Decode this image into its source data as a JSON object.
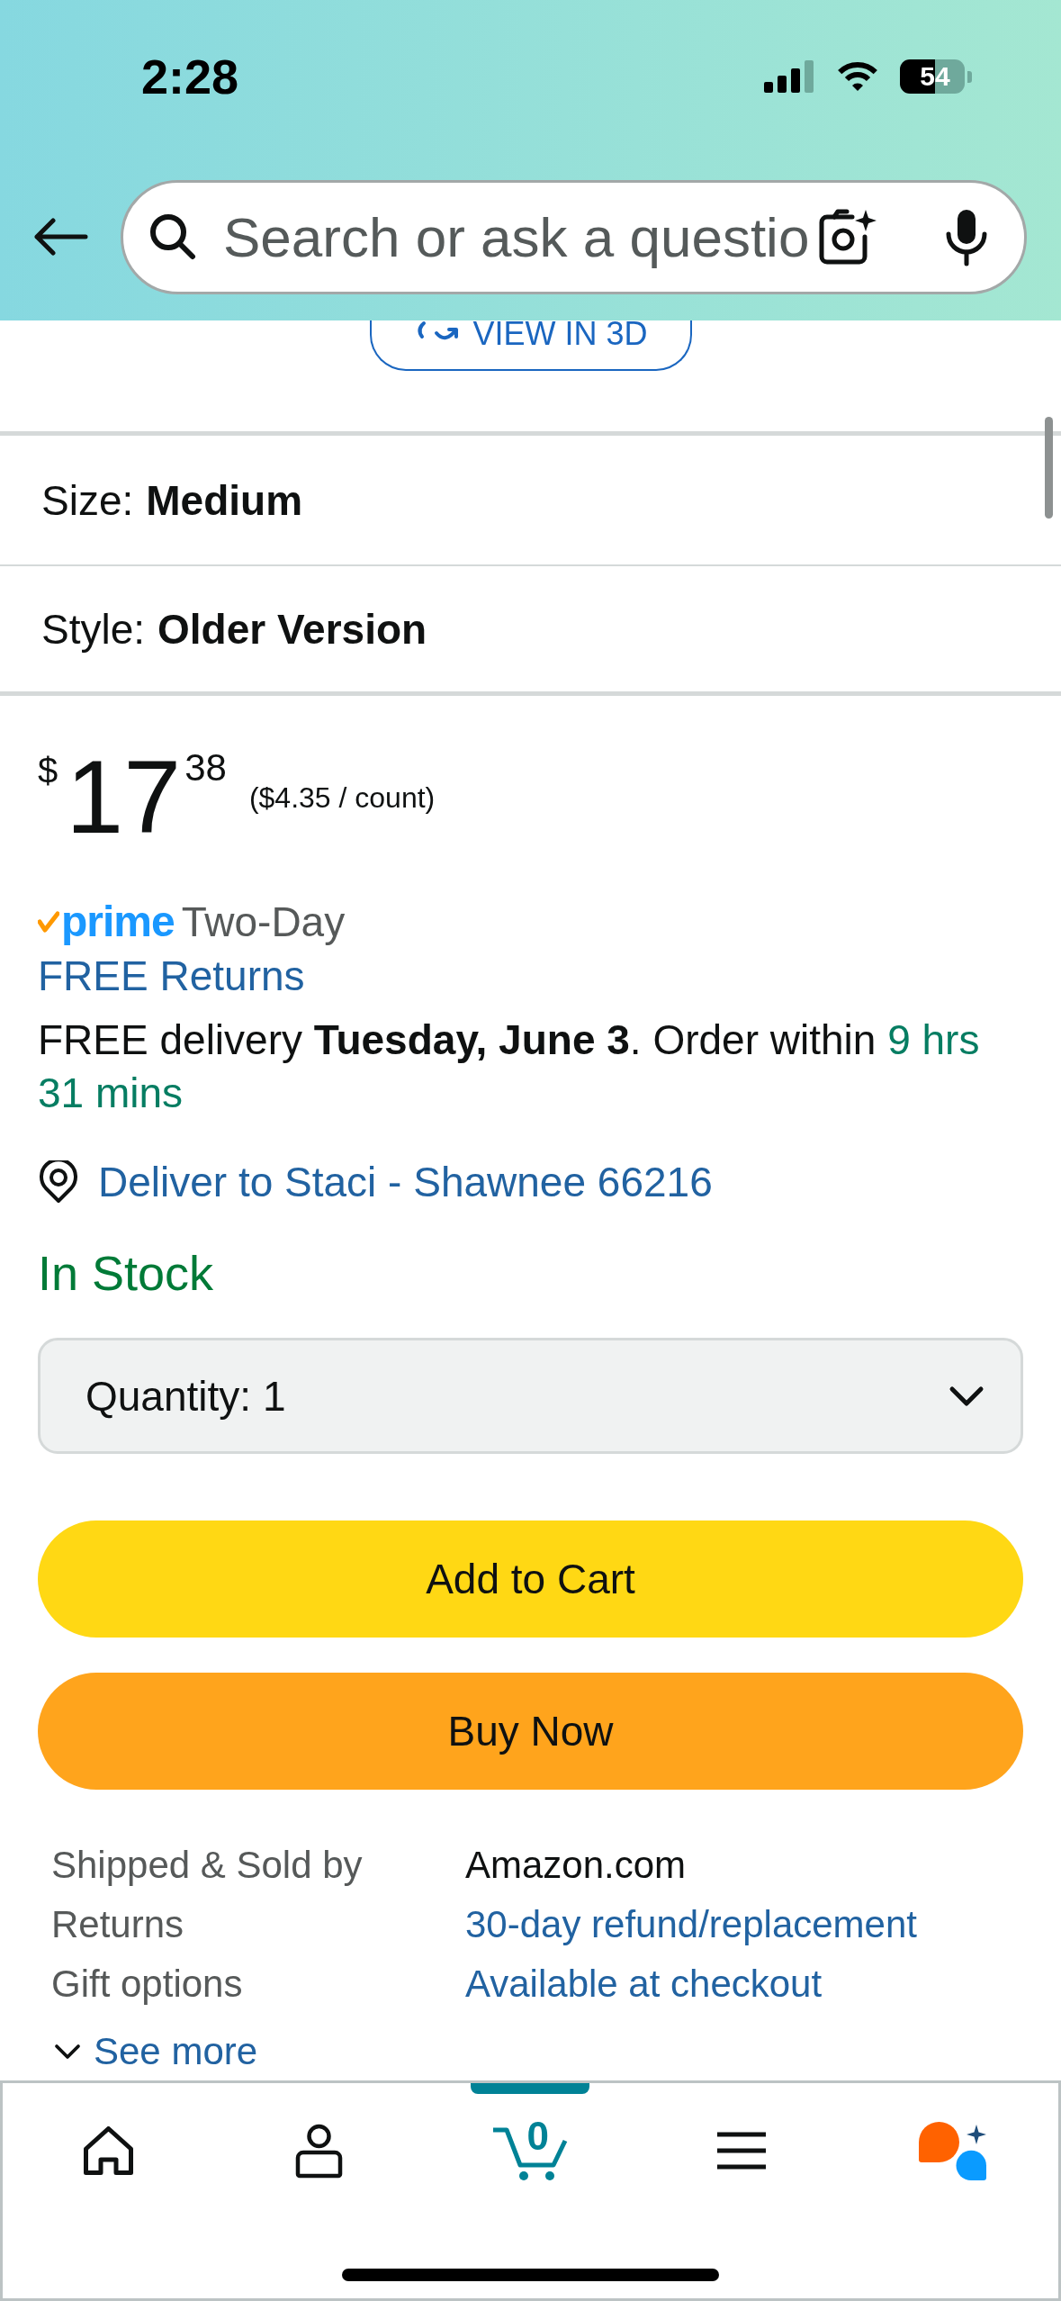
{
  "status_bar": {
    "time": "2:28",
    "battery": "54"
  },
  "search": {
    "placeholder": "Search or ask a questio"
  },
  "view_3d_button": {
    "label": "VIEW IN 3D"
  },
  "variations": [
    {
      "label": "Size:",
      "value": "Medium"
    },
    {
      "label": "Style:",
      "value": "Older Version"
    }
  ],
  "price": {
    "currency": "$",
    "whole": "17",
    "fraction": "38",
    "unit_price": "($4.35 / count)"
  },
  "delivery": {
    "prime_badge": "prime",
    "speed": "Two-Day",
    "returns": "FREE Returns",
    "message": "FREE delivery **Tuesday, June 3**. Order within",
    "countdown": "9 hrs 31 mins",
    "location": "Deliver to Staci - Shawnee 66216"
  },
  "stock_status": "In Stock",
  "quantity": {
    "label": "Quantity:",
    "value": "1"
  },
  "buttons": [
    {
      "kind": "add_to_cart",
      "label": "Add to Cart"
    },
    {
      "kind": "buy_now",
      "label": "Buy Now"
    }
  ],
  "details": [
    {
      "kind": "text",
      "label": "Shipped & Sold by",
      "value": "Amazon.com"
    },
    {
      "kind": "link",
      "label": "Returns",
      "value": "30-day refund/replacement"
    },
    {
      "kind": "link",
      "label": "Gift options",
      "value": "Available at checkout"
    }
  ],
  "see_more": "See more",
  "bottom_nav": {
    "items": [
      {
        "kind": "home",
        "selected": false
      },
      {
        "kind": "account",
        "selected": false
      },
      {
        "kind": "cart",
        "selected": true,
        "count": "0"
      },
      {
        "kind": "menu",
        "selected": false
      },
      {
        "kind": "assistant",
        "selected": false
      }
    ]
  }
}
